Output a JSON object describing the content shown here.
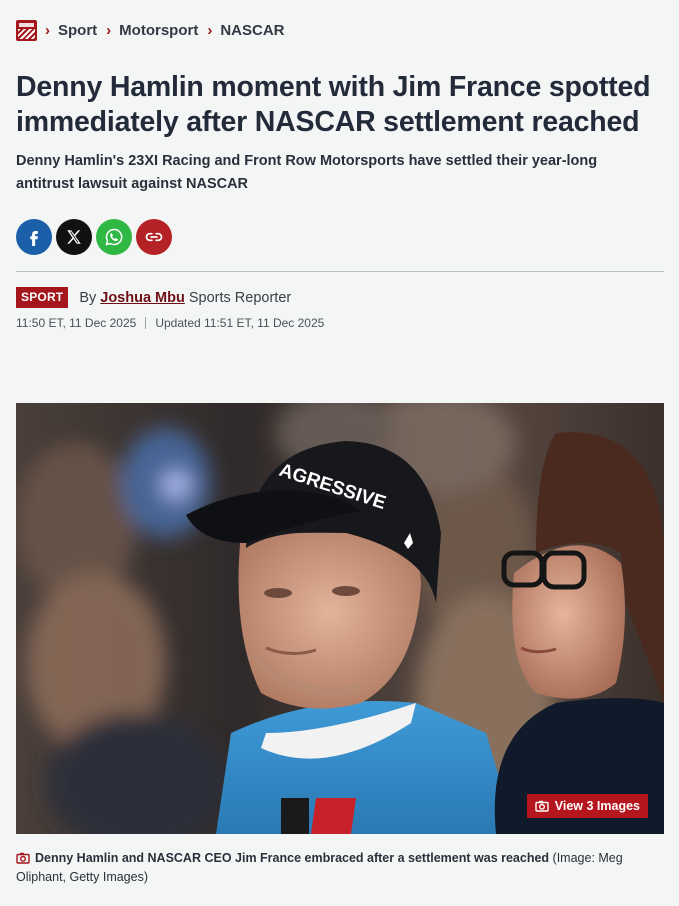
{
  "breadcrumb": {
    "logo_name": "site-logo",
    "items": [
      "Sport",
      "Motorsport",
      "NASCAR"
    ]
  },
  "article": {
    "title": "Denny Hamlin moment with Jim France spotted immediately after NASCAR settlement reached",
    "standfirst": "Denny Hamlin's 23XI Racing and Front Row Motorsports have settled their year-long antitrust lawsuit against NASCAR",
    "section_badge": "SPORT",
    "by_label": "By",
    "author": "Joshua Mbu",
    "author_role": "Sports Reporter",
    "published": "11:50 ET, 11 Dec 2025",
    "updated": "Updated 11:51 ET, 11 Dec 2025"
  },
  "share": {
    "icons": [
      "facebook-icon",
      "x-icon",
      "whatsapp-icon",
      "link-icon"
    ]
  },
  "hero": {
    "view_images_label": "View 3 Images",
    "cap_text": "AGRESSIVE",
    "caption_main": "Denny Hamlin and NASCAR CEO Jim France embraced after a settlement was reached",
    "caption_credit": "(Image: Meg Oliphant, Getty Images)"
  },
  "colors": {
    "brand": "#a4151c",
    "facebook": "#1b5fa8",
    "x": "#111111",
    "whatsapp": "#30b844",
    "link": "#b52226"
  }
}
